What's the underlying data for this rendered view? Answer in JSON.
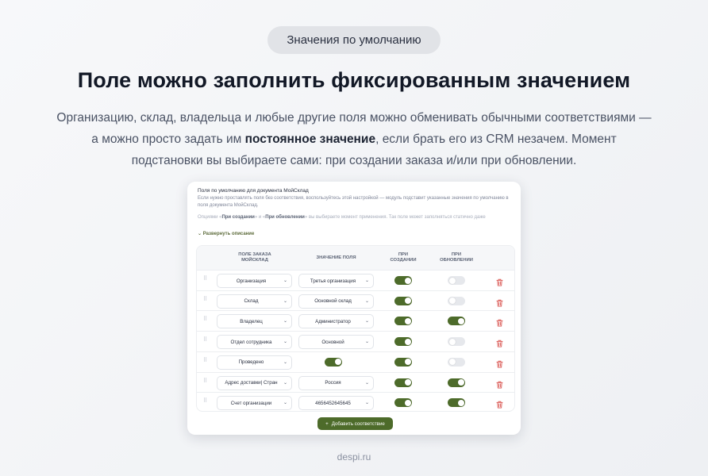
{
  "badge": "Значения по умолчанию",
  "headline": "Поле можно заполнить фиксированным значением",
  "lead": {
    "part1": "Организацию, склад, владельца и любые другие поля можно обменивать обычными соответствиями — а можно просто задать им ",
    "bold": "постоянное значение",
    "part2": ", если брать его из CRM незачем. Момент подстановки вы выбираете сами: при создании заказа и/или при обновлении."
  },
  "card": {
    "title": "Поля по умолчанию для документа МойСклад",
    "desc": "Если нужно проставлять поля без соответствия, воспользуйтесь этой настройкой — модуль подставит указанные значения по умолчанию в поля документа МойСклад.",
    "opts": {
      "prefix": "Опциями «",
      "opt1": "При создании",
      "mid": "» и «",
      "opt2": "При обновлении",
      "suffix": "» вы выбираете момент применения. Так поле может заполняться статично даже"
    },
    "expand": "Развернуть описание",
    "headers": {
      "field": "ПОЛЕ ЗАКАЗА МОЙСКЛАД",
      "value": "ЗНАЧЕНИЕ ПОЛЯ",
      "create": "ПРИ СОЗДАНИИ",
      "update": "ПРИ ОБНОВЛЕНИИ"
    },
    "rows": [
      {
        "field": "Организация",
        "value": "Третья организация",
        "value_is_toggle": false,
        "value_on": false,
        "create": true,
        "update": false
      },
      {
        "field": "Склад",
        "value": "Основной склад",
        "value_is_toggle": false,
        "value_on": false,
        "create": true,
        "update": false
      },
      {
        "field": "Владелец",
        "value": "Администратор",
        "value_is_toggle": false,
        "value_on": false,
        "create": true,
        "update": true
      },
      {
        "field": "Отдел сотрудника",
        "value": "Основной",
        "value_is_toggle": false,
        "value_on": false,
        "create": true,
        "update": false
      },
      {
        "field": "Проведено",
        "value": "",
        "value_is_toggle": true,
        "value_on": true,
        "create": true,
        "update": false
      },
      {
        "field": "Адрес доставки| Стран",
        "value": "Россия",
        "value_is_toggle": false,
        "value_on": false,
        "create": true,
        "update": true
      },
      {
        "field": "Счет организации",
        "value": "4656452645645",
        "value_is_toggle": false,
        "value_on": false,
        "create": true,
        "update": true
      }
    ],
    "add_button": "Добавить соответствие"
  },
  "footer": "despi.ru",
  "colors": {
    "accent": "#4d6b2a",
    "trash": "#d9534f"
  },
  "icons": {
    "grip": "drag-handle-icon",
    "chevron": "chevron-down-icon",
    "trash": "trash-icon",
    "plus": "plus-icon"
  }
}
